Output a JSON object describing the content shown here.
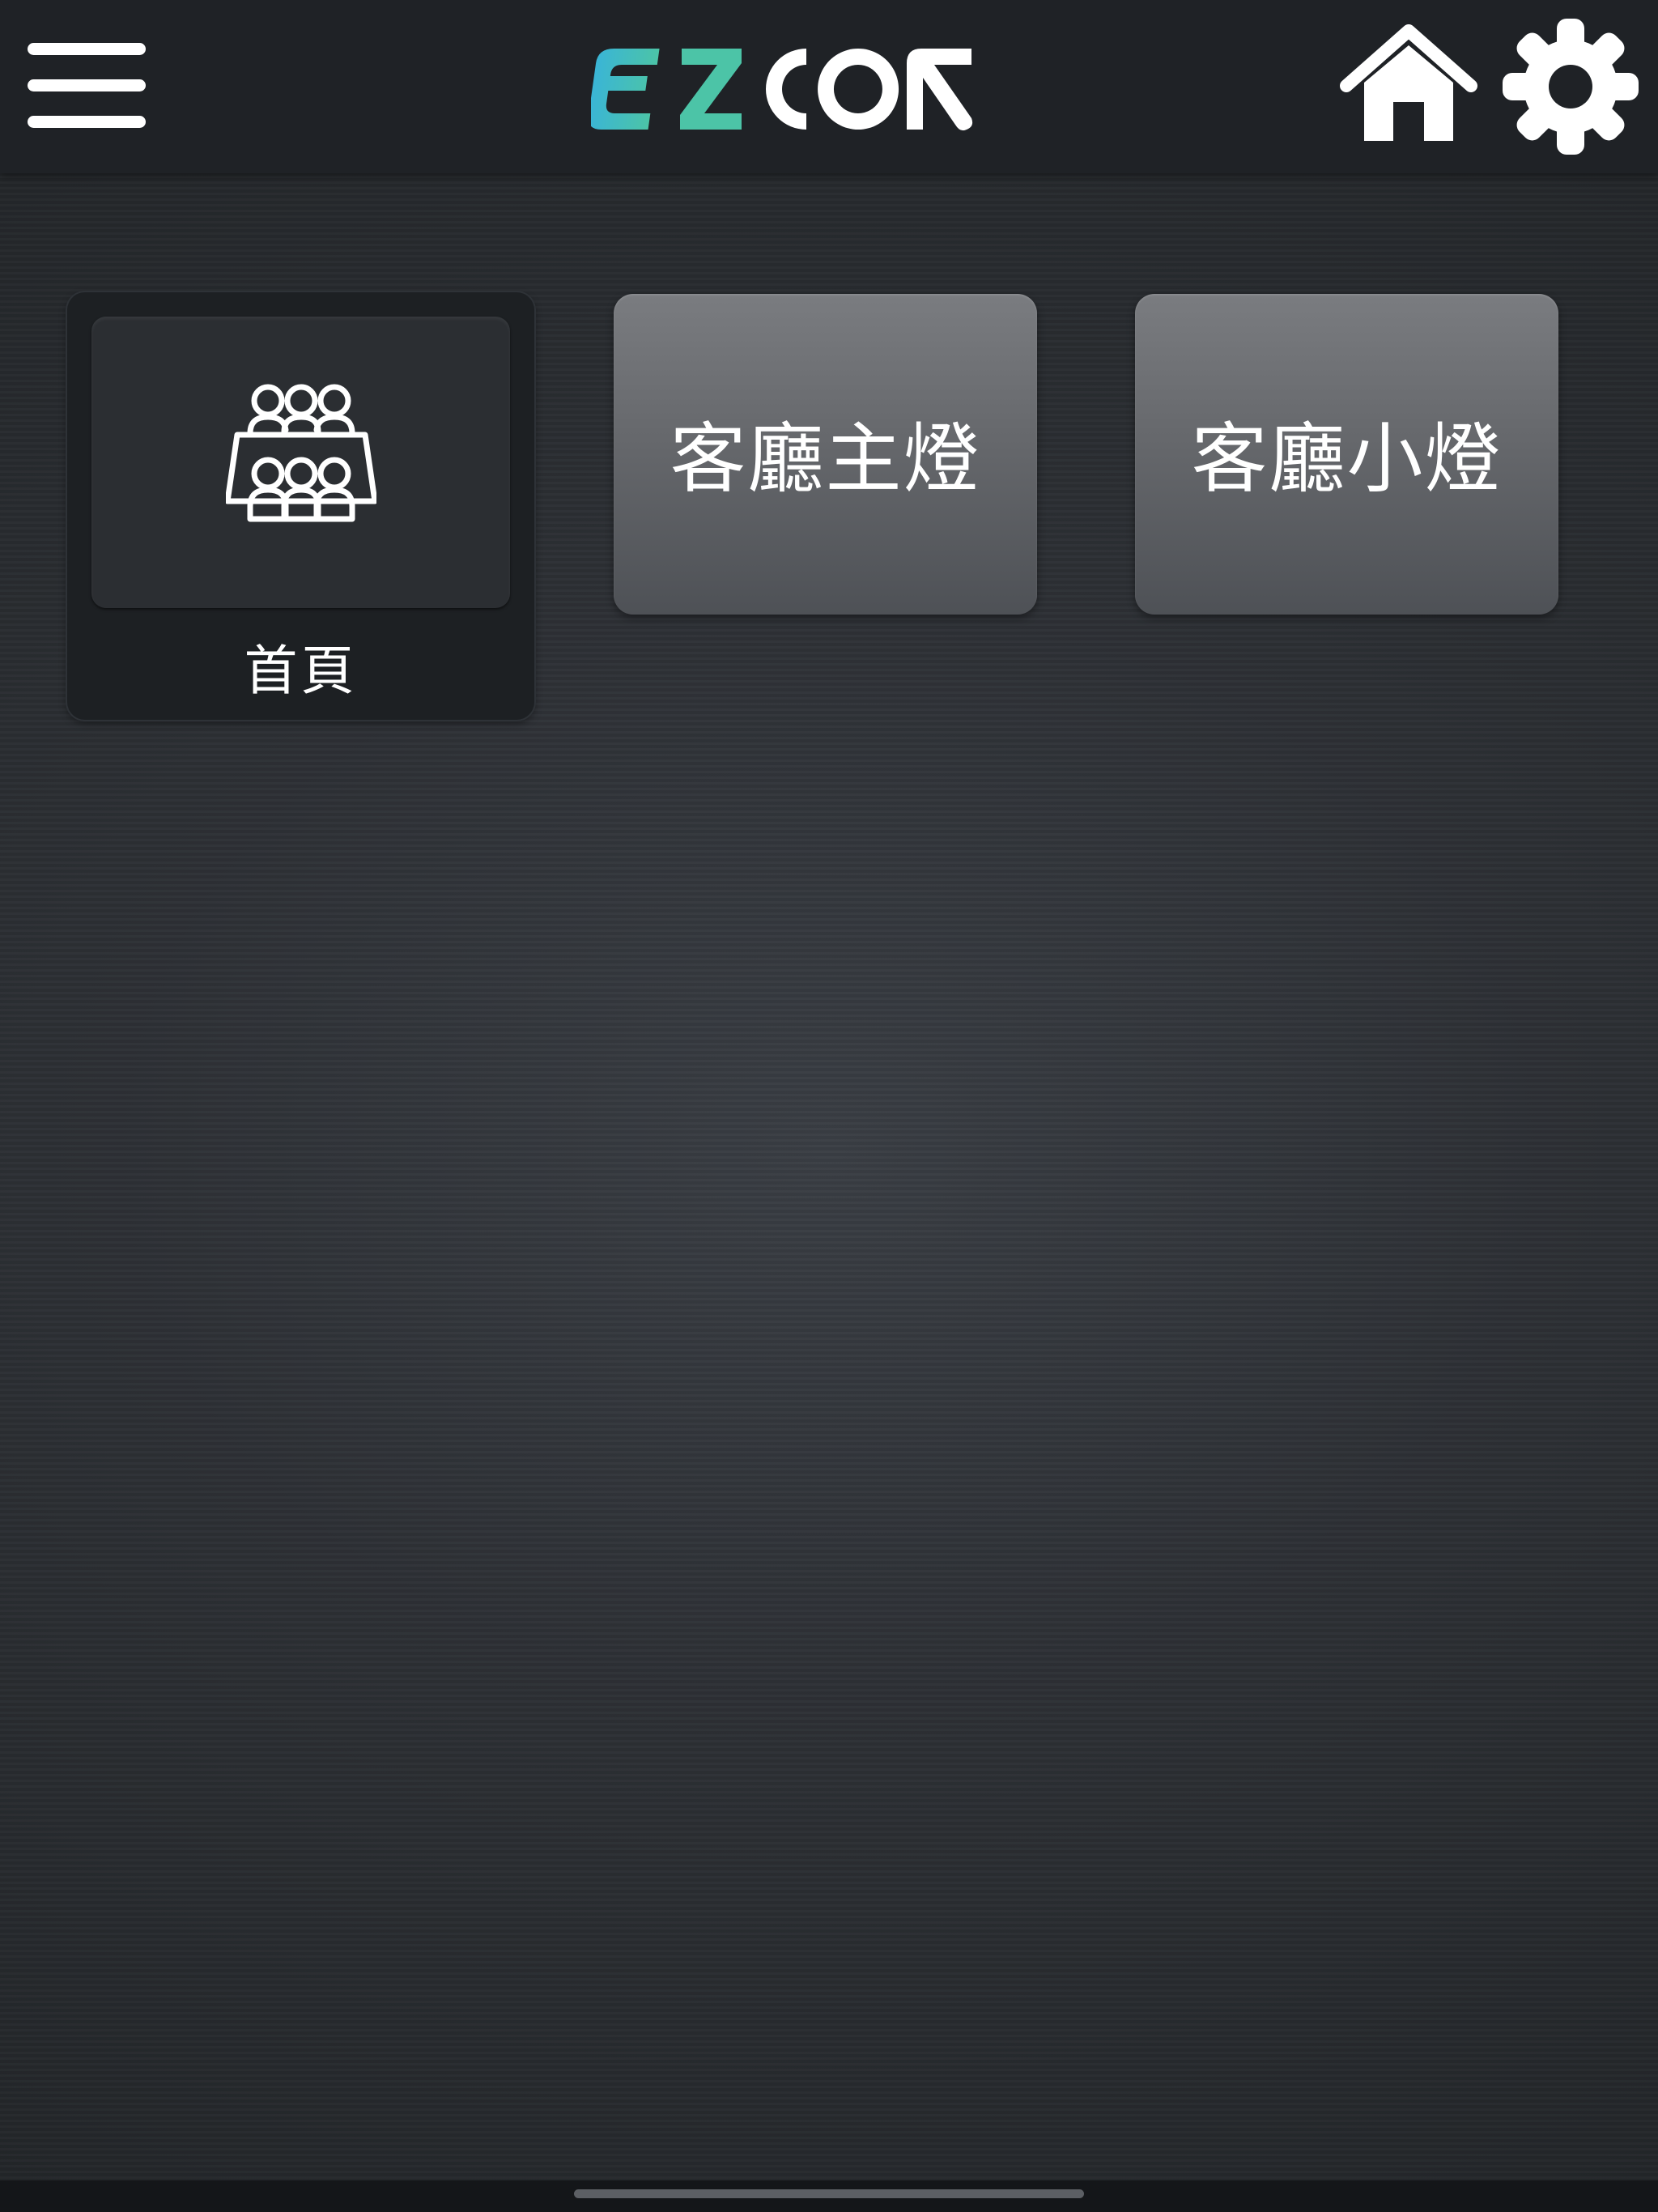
{
  "header": {
    "logo_text": "EZCON",
    "logo_colors": [
      "#3ab5d6",
      "#4cc4a7",
      "#ffffff"
    ],
    "menu_icon": "hamburger-menu-icon",
    "home_icon": "home-icon",
    "settings_icon": "gear-icon"
  },
  "tiles": [
    {
      "label": "首頁",
      "icon": "people-group-icon",
      "selected": true
    },
    {
      "label": "客廳主燈",
      "selected": false
    },
    {
      "label": "客廳小燈",
      "selected": false
    }
  ],
  "colors": {
    "header_bg": "#1f2226",
    "background": "#2d3035",
    "tile_button": "#6a6c70",
    "selected_tile": "#1d2023"
  }
}
